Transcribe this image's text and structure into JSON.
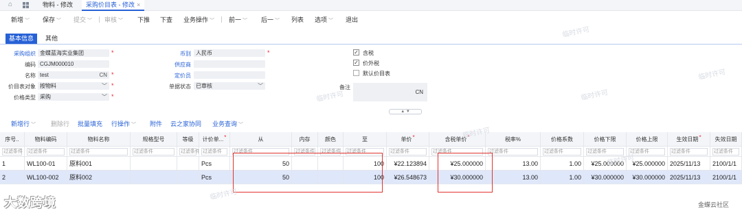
{
  "tabs": {
    "home_icon": "home-icon",
    "t1": "物料 - 修改",
    "t2": "采购价目表 - 修改",
    "close": "×"
  },
  "toolbar": {
    "new": "新增",
    "save": "保存",
    "submit": "提交",
    "audit": "审核",
    "push": "下推",
    "query": "下查",
    "bizop": "业务操作",
    "prev": "前一",
    "next": "后一",
    "list": "列表",
    "options": "选项",
    "exit": "退出"
  },
  "form_tabs": {
    "basic": "基本信息",
    "other": "其他"
  },
  "form": {
    "org_label": "采购组织",
    "org_value": "金蝶蓝海实业集团",
    "code_label": "编码",
    "code_value": "CGJM000010",
    "name_label": "名称",
    "name_value": "test",
    "name_suffix": "CN",
    "obj_label": "价目表对象",
    "obj_value": "按物料",
    "type_label": "价格类型",
    "type_value": "采购",
    "currency_label": "币别",
    "currency_value": "人民币",
    "supplier_label": "供应商",
    "pricer_label": "定价员",
    "status_label": "单据状态",
    "status_value": "已审核",
    "tax_label": "含税",
    "vat_label": "价外税",
    "default_label": "默认价目表",
    "memo_label": "备注",
    "memo_suffix": "CN",
    "required": "*",
    "check": "✓"
  },
  "grid_toolbar": {
    "add": "新增行",
    "del": "删除行",
    "batch": "批量填充",
    "rowop": "行操作",
    "attach": "附件",
    "cloud": "云之家协同",
    "bizquery": "业务查询"
  },
  "table": {
    "headers": [
      "序号..",
      "物料编码",
      "物料名称",
      "规格型号",
      "等级",
      "计价单...",
      "从",
      "内存",
      "颜色",
      "至",
      "单价",
      "含税单价",
      "税率%",
      "价格系数",
      "价格下限",
      "价格上限",
      "生效日期",
      "失效日期"
    ],
    "filter": "过滤条件",
    "rows": [
      [
        "1",
        "WL100-01",
        "原料001",
        "",
        "",
        "Pcs",
        "50",
        "",
        "",
        "100",
        "¥22.123894",
        "¥25.000000",
        "13.00",
        "1.00",
        "¥25.000000",
        "¥25.000000",
        "2025/11/13",
        "2100/1/1"
      ],
      [
        "2",
        "WL100-002",
        "原料002",
        "",
        "",
        "Pcs",
        "50",
        "",
        "",
        "100",
        "¥26.548673",
        "¥30.000000",
        "13.00",
        "1.00",
        "¥30.000000",
        "¥30.000000",
        "2025/11/13",
        "2100/1/1"
      ]
    ]
  },
  "watermark": "临时许可",
  "footer": {
    "logo": "大数跨境",
    "credit": "金蝶云社区"
  }
}
